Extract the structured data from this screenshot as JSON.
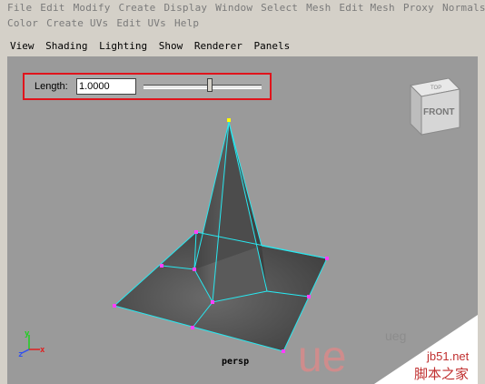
{
  "menus": {
    "row1": [
      "File",
      "Edit",
      "Modify",
      "Create",
      "Display",
      "Window",
      "Select",
      "Mesh",
      "Edit Mesh",
      "Proxy",
      "Normals"
    ],
    "row2": [
      "Color",
      "Create UVs",
      "Edit UVs",
      "Help"
    ]
  },
  "panel_menu": [
    "View",
    "Shading",
    "Lighting",
    "Show",
    "Renderer",
    "Panels"
  ],
  "tool": {
    "label": "Length:",
    "value": "1.0000",
    "slider_fraction": 0.56
  },
  "viewcube": {
    "top": "TOP",
    "front": "FRONT"
  },
  "camera": "persp",
  "axes": {
    "x": "x",
    "y": "y",
    "z": "z"
  },
  "colors": {
    "mesh": "#555555",
    "wire": "#28e8f0",
    "vertex": "#ff40ff",
    "tip": "#ffff00",
    "highlight": "#e0141c"
  },
  "watermark": {
    "site": "jb51.net",
    "name": "脚本之家",
    "logo": "ue",
    "logo_text": "ueg"
  }
}
